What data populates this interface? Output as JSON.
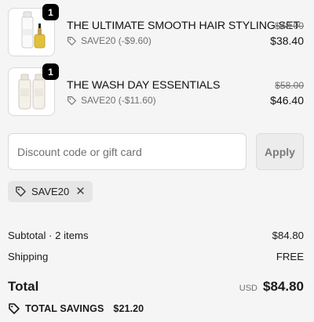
{
  "line_items": [
    {
      "quantity": "1",
      "name": "THE ULTIMATE SMOOTH HAIR STYLING SET",
      "discount": "SAVE20 (-$9.60)",
      "original_price": "$48.00",
      "price": "$38.40"
    },
    {
      "quantity": "1",
      "name": "THE WASH DAY ESSENTIALS",
      "discount": "SAVE20 (-$11.60)",
      "original_price": "$58.00",
      "price": "$46.40"
    }
  ],
  "discount_form": {
    "placeholder": "Discount code or gift card",
    "value": "",
    "apply_label": "Apply"
  },
  "applied_code": {
    "label": "SAVE20",
    "remove_icon": "close-icon"
  },
  "summary": {
    "subtotal_label": "Subtotal · 2 items",
    "subtotal_value": "$84.80",
    "shipping_label": "Shipping",
    "shipping_value": "FREE",
    "total_label": "Total",
    "currency": "USD",
    "total_value": "$84.80",
    "savings_label": "TOTAL SAVINGS",
    "savings_value": "$21.20"
  },
  "icons": {
    "tag": "tag-icon",
    "close": "close-icon"
  },
  "colors": {
    "background": "#f5f5f5",
    "muted_text": "#707070",
    "badge": "#000000"
  }
}
